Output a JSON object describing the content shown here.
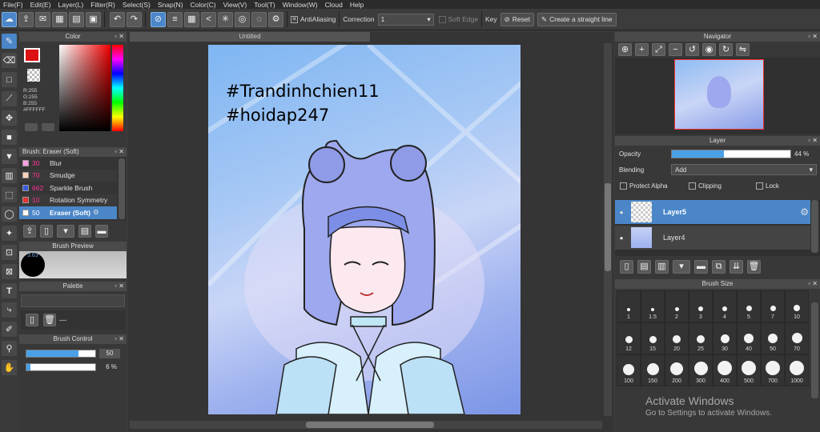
{
  "menu": [
    "File(F)",
    "Edit(E)",
    "Layer(L)",
    "Filter(R)",
    "Select(S)",
    "Snap(N)",
    "Color(C)",
    "View(V)",
    "Tool(T)",
    "Window(W)",
    "Cloud",
    "Help"
  ],
  "toolbar": {
    "antialiasing": "AntiAliasing",
    "correction_label": "Correction",
    "correction_value": "1",
    "soft_edge": "Soft Edge",
    "key_label": "Key",
    "reset": "Reset",
    "straight_line": "Create a straight line"
  },
  "color_panel": {
    "title": "Color",
    "r": "R:255",
    "g": "G:255",
    "b": "B:255",
    "hex": "#FFFFFF"
  },
  "brush_panel": {
    "title": "Brush: Eraser (Soft)",
    "items": [
      {
        "size": "30",
        "name": "Blur",
        "color": "#ff9ee6"
      },
      {
        "size": "70",
        "name": "Smudge",
        "color": "#ffd3b8"
      },
      {
        "size": "662",
        "name": "Sparkle Brush",
        "color": "#3b5bdc"
      },
      {
        "size": "10",
        "name": "Rotation Symmetry",
        "color": "#e83030"
      },
      {
        "size": "50",
        "name": "Eraser (Soft)",
        "color": "#ffffff"
      }
    ]
  },
  "brush_preview": {
    "title": "Brush Preview",
    "size": "3.63"
  },
  "palette": {
    "title": "Palette",
    "text": "---"
  },
  "brush_control": {
    "title": "Brush Control",
    "size": "50",
    "opacity": "6 %",
    "size_fraction": 0.75,
    "opacity_fraction": 0.06
  },
  "canvas": {
    "tab_title": "Untitled",
    "text_line1": "#Trandinhchien11",
    "text_line2": "#hoidap247"
  },
  "navigator": {
    "title": "Navigator"
  },
  "layer_panel": {
    "title": "Layer",
    "opacity_label": "Opacity",
    "opacity_value": "44 %",
    "opacity_fraction": 0.44,
    "blending_label": "Blending",
    "blending_value": "Add",
    "protect_alpha": "Protect Alpha",
    "clipping": "Clipping",
    "lock": "Lock",
    "layers": [
      {
        "name": "Layer5",
        "selected": true
      },
      {
        "name": "Layer4",
        "selected": false
      }
    ]
  },
  "brush_size": {
    "title": "Brush Size",
    "sizes": [
      "1",
      "1.5",
      "2",
      "3",
      "4",
      "5",
      "7",
      "10",
      "12",
      "15",
      "20",
      "25",
      "30",
      "40",
      "50",
      "70",
      "100",
      "150",
      "200",
      "300",
      "400",
      "500",
      "700",
      "1000"
    ]
  },
  "watermark": {
    "line1": "Activate Windows",
    "line2": "Go to Settings to activate Windows."
  }
}
